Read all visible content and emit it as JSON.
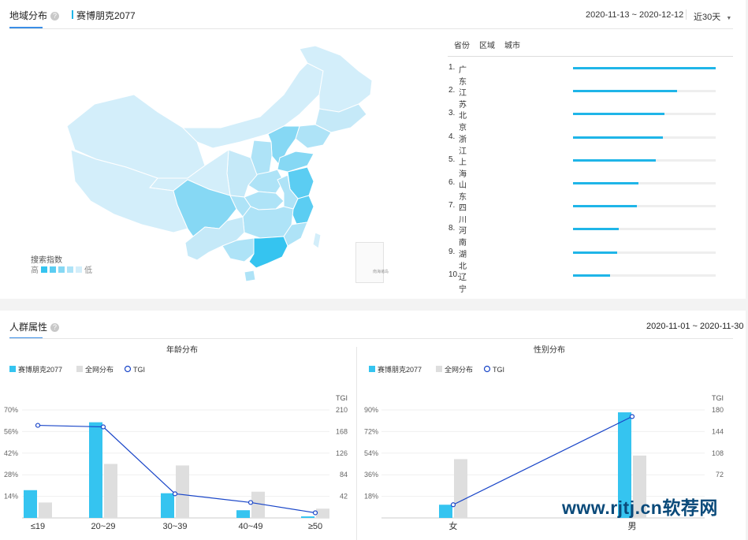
{
  "geo": {
    "tab_label": "地域分布",
    "keyword": "赛博朋克2077",
    "date_range": "2020-11-13 ~ 2020-12-12",
    "range_select": "近30天",
    "legend": {
      "title": "搜索指数",
      "high": "高",
      "low": "低",
      "colors": [
        "#35c4f0",
        "#5bcdf2",
        "#86d8f4",
        "#aee3f7",
        "#d3eefa"
      ]
    },
    "map_inset": "南海诸岛",
    "rank_tabs": [
      "省份",
      "区域",
      "城市"
    ],
    "ranking": [
      {
        "num": "1.",
        "name": "广东",
        "value": 100
      },
      {
        "num": "2.",
        "name": "江苏",
        "value": 73
      },
      {
        "num": "3.",
        "name": "北京",
        "value": 64
      },
      {
        "num": "4.",
        "name": "浙江",
        "value": 63
      },
      {
        "num": "5.",
        "name": "上海",
        "value": 58
      },
      {
        "num": "6.",
        "name": "山东",
        "value": 46
      },
      {
        "num": "7.",
        "name": "四川",
        "value": 45
      },
      {
        "num": "8.",
        "name": "河南",
        "value": 32
      },
      {
        "num": "9.",
        "name": "湖北",
        "value": 31
      },
      {
        "num": "10.",
        "name": "辽宁",
        "value": 26
      }
    ]
  },
  "crowd": {
    "title": "人群属性",
    "date_range": "2020-11-01 ~ 2020-11-30"
  },
  "chart_data": [
    {
      "type": "bar",
      "title": "年龄分布",
      "categories": [
        "≤19",
        "20~29",
        "30~39",
        "40~49",
        "≥50"
      ],
      "series": [
        {
          "name": "赛博朋克2077",
          "kind": "bar",
          "color": "#35c4f0",
          "values": [
            18,
            62,
            16,
            5,
            1
          ]
        },
        {
          "name": "全网分布",
          "kind": "bar",
          "color": "#dedede",
          "values": [
            10,
            35,
            34,
            17,
            6
          ]
        },
        {
          "name": "TGI",
          "kind": "line",
          "axis": "right",
          "color": "#1a46c8",
          "values": [
            180,
            177,
            47,
            30,
            10
          ]
        }
      ],
      "ylim": [
        0,
        70
      ],
      "yticks": [
        "14%",
        "28%",
        "42%",
        "56%",
        "70%"
      ],
      "y2label": "TGI",
      "y2lim": [
        0,
        210
      ],
      "y2ticks": [
        "42",
        "84",
        "126",
        "168",
        "210"
      ]
    },
    {
      "type": "bar",
      "title": "性别分布",
      "categories": [
        "女",
        "男"
      ],
      "series": [
        {
          "name": "赛博朋克2077",
          "kind": "bar",
          "color": "#35c4f0",
          "values": [
            11,
            88
          ]
        },
        {
          "name": "全网分布",
          "kind": "bar",
          "color": "#dedede",
          "values": [
            49,
            52
          ]
        },
        {
          "name": "TGI",
          "kind": "line",
          "axis": "right",
          "color": "#1a46c8",
          "values": [
            22,
            169
          ]
        }
      ],
      "ylim": [
        0,
        90
      ],
      "yticks": [
        "18%",
        "36%",
        "54%",
        "72%",
        "90%"
      ],
      "y2label": "TGI",
      "y2lim": [
        0,
        180
      ],
      "y2ticks": [
        "72",
        "108",
        "144",
        "180"
      ]
    }
  ],
  "watermark": "www.rjtj.cn软荐网"
}
